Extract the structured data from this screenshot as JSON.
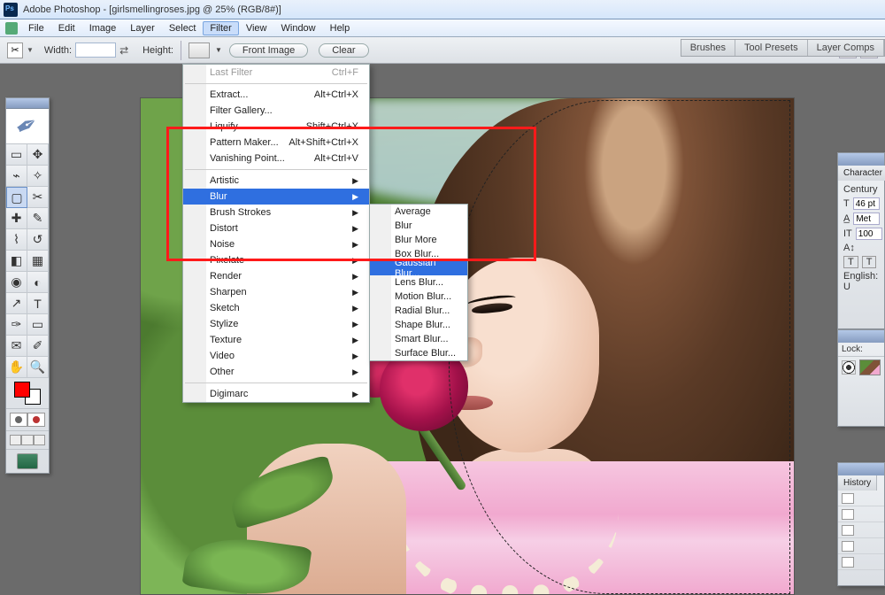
{
  "title": "Adobe Photoshop - [girlsmellingroses.jpg @ 25% (RGB/8#)]",
  "menubar": [
    "File",
    "Edit",
    "Image",
    "Layer",
    "Select",
    "Filter",
    "View",
    "Window",
    "Help"
  ],
  "menubar_open_index": 5,
  "optionsbar": {
    "width_label": "Width:",
    "height_label": "Height:",
    "width_value": "",
    "height_value": "",
    "front_image": "Front Image",
    "clear": "Clear"
  },
  "palette_tabs": [
    "Brushes",
    "Tool Presets",
    "Layer Comps"
  ],
  "filter_menu": {
    "last_filter": {
      "label": "Last Filter",
      "shortcut": "Ctrl+F",
      "disabled": true
    },
    "group1": [
      {
        "label": "Extract...",
        "shortcut": "Alt+Ctrl+X"
      },
      {
        "label": "Filter Gallery...",
        "shortcut": ""
      },
      {
        "label": "Liquify...",
        "shortcut": "Shift+Ctrl+X"
      },
      {
        "label": "Pattern Maker...",
        "shortcut": "Alt+Shift+Ctrl+X"
      },
      {
        "label": "Vanishing Point...",
        "shortcut": "Alt+Ctrl+V"
      }
    ],
    "group2": [
      "Artistic",
      "Blur",
      "Brush Strokes",
      "Distort",
      "Noise",
      "Pixelate",
      "Render",
      "Sharpen",
      "Sketch",
      "Stylize",
      "Texture",
      "Video",
      "Other"
    ],
    "group2_highlight_index": 1,
    "group3": [
      "Digimarc"
    ]
  },
  "blur_submenu": {
    "items": [
      "Average",
      "Blur",
      "Blur More",
      "Box Blur...",
      "Gaussian Blur...",
      "Lens Blur...",
      "Motion Blur...",
      "Radial Blur...",
      "Shape Blur...",
      "Smart Blur...",
      "Surface Blur..."
    ],
    "highlight_index": 4
  },
  "character_panel": {
    "title": "Character",
    "font": "Century",
    "size": "46 pt",
    "leading": "Met",
    "tracking": "100",
    "color_label": "T",
    "lang": "English: U"
  },
  "layers_panel": {
    "lock_label": "Lock:"
  },
  "history_panel": {
    "title": "History"
  },
  "colors": {
    "highlight": "#2f6fe0",
    "redbox": "#ff1a1a"
  }
}
